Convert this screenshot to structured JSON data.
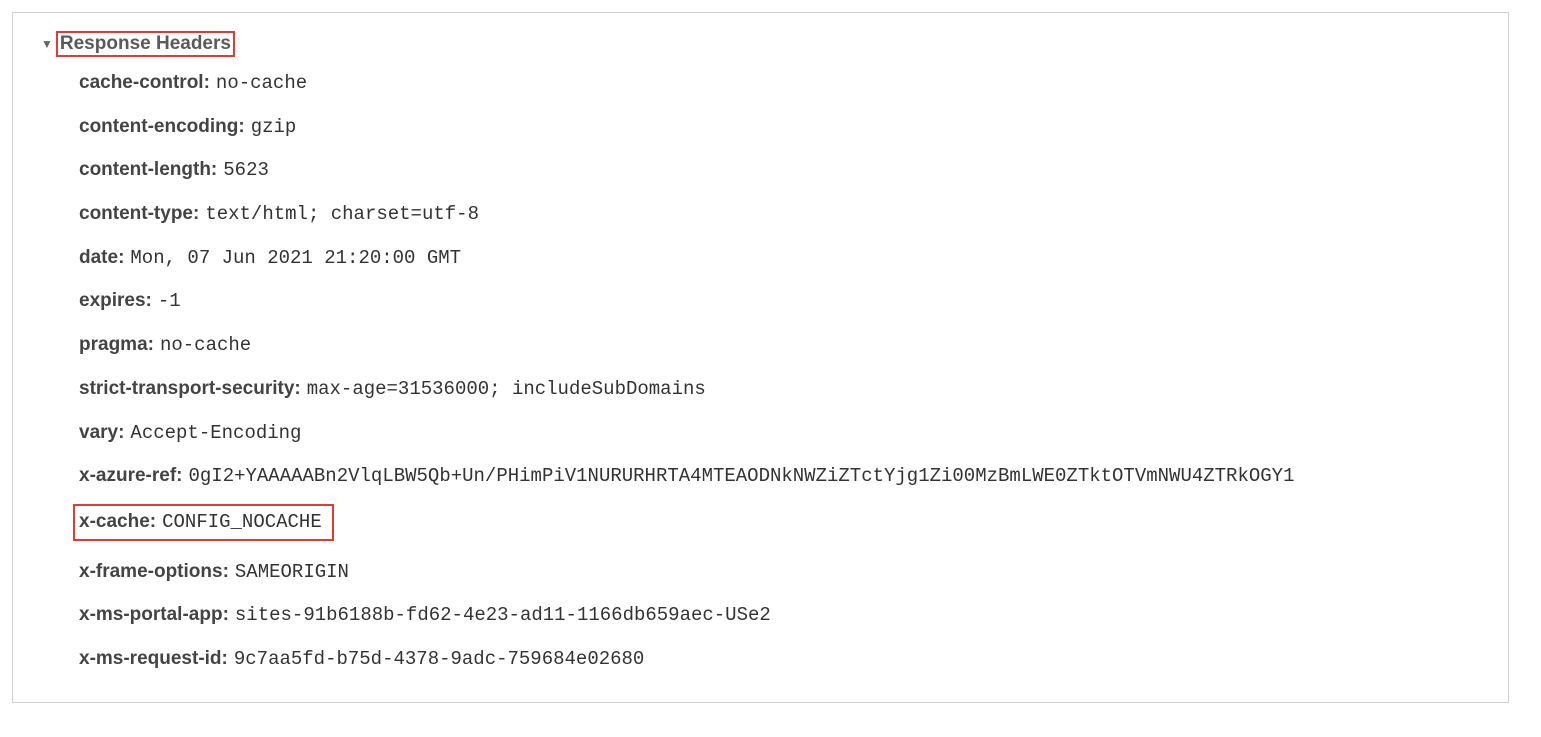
{
  "section": {
    "title": "Response Headers"
  },
  "headers": {
    "cacheControl": {
      "name": "cache-control:",
      "value": "no-cache"
    },
    "contentEncoding": {
      "name": "content-encoding:",
      "value": "gzip"
    },
    "contentLength": {
      "name": "content-length:",
      "value": "5623"
    },
    "contentType": {
      "name": "content-type:",
      "value": "text/html; charset=utf-8"
    },
    "date": {
      "name": "date:",
      "value": "Mon, 07 Jun 2021 21:20:00 GMT"
    },
    "expires": {
      "name": "expires:",
      "value": "-1"
    },
    "pragma": {
      "name": "pragma:",
      "value": "no-cache"
    },
    "strictTransportSecurity": {
      "name": "strict-transport-security:",
      "value": "max-age=31536000; includeSubDomains"
    },
    "vary": {
      "name": "vary:",
      "value": "Accept-Encoding"
    },
    "xAzureRef": {
      "name": "x-azure-ref:",
      "value": "0gI2+YAAAAABn2VlqLBW5Qb+Un/PHimPiV1NURURHRTA4MTEAODNkNWZiZTctYjg1Zi00MzBmLWE0ZTktOTVmNWU4ZTRkOGY1"
    },
    "xCache": {
      "name": "x-cache:",
      "value": "CONFIG_NOCACHE"
    },
    "xFrameOptions": {
      "name": "x-frame-options:",
      "value": "SAMEORIGIN"
    },
    "xMsPortalApp": {
      "name": "x-ms-portal-app:",
      "value": "sites-91b6188b-fd62-4e23-ad11-1166db659aec-USe2"
    },
    "xMsRequestId": {
      "name": "x-ms-request-id:",
      "value": "9c7aa5fd-b75d-4378-9adc-759684e02680"
    }
  }
}
